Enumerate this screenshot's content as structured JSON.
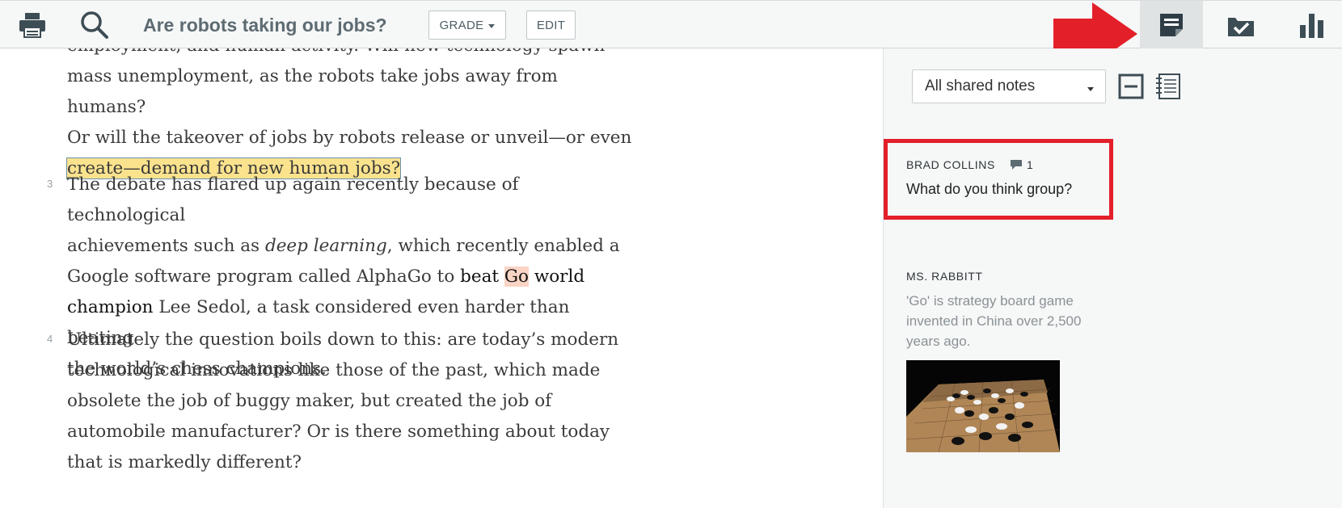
{
  "toolbar": {
    "title": "Are robots taking our jobs?",
    "grade_label": "GRADE",
    "edit_label": "EDIT",
    "icons": [
      "printer-icon",
      "search-icon"
    ],
    "right_tabs": [
      "notes-tab",
      "assignment-tab",
      "stats-tab"
    ],
    "active_tab": "notes-tab"
  },
  "reading": {
    "cut_line": "employment, and human activity. Will new technology spawn",
    "p2_lines": [
      "mass unemployment, as the robots take jobs away from humans?",
      "Or will the takeover of jobs by robots release or unveil—or even"
    ],
    "p2_highlight": "create—demand for new human jobs?",
    "p3_num": "3",
    "p3": {
      "l1": "The debate has flared up again recently because of technological",
      "l2_a": "achievements such as ",
      "l2_em": "deep learning",
      "l2_b": ", which recently enabled a",
      "l3_a": "Google software program called AlphaGo to ",
      "l3_beat": "beat ",
      "l3_go": "Go",
      "l3_world": " world",
      "l4_champ": "champion",
      "l4_b": " Lee Sedol, a task considered even harder than beating",
      "l5": "the world’s chess champions."
    },
    "p4_num": "4",
    "p4_lines": [
      "Ultimately the question boils down to this: are today’s modern",
      "technological innovations like those of the past, which made",
      "obsolete the job of buggy maker, but created the job of",
      "automobile manufacturer? Or is there something about today",
      "that is markedly different?"
    ]
  },
  "notes": {
    "filter_value": "All shared notes",
    "note1": {
      "author": "BRAD COLLINS",
      "reply_count": "1",
      "text": "What do you think group?"
    },
    "note2": {
      "author": "MS. RABBITT",
      "lines": [
        "'Go' is strategy board game",
        "invented in China over 2,500",
        "years ago."
      ]
    }
  },
  "colors": {
    "annotation_red": "#e3202a",
    "highlight_yellow": "#fbe38e",
    "highlight_salmon": "#fad4c4",
    "icon_slate": "#3d4d55"
  }
}
